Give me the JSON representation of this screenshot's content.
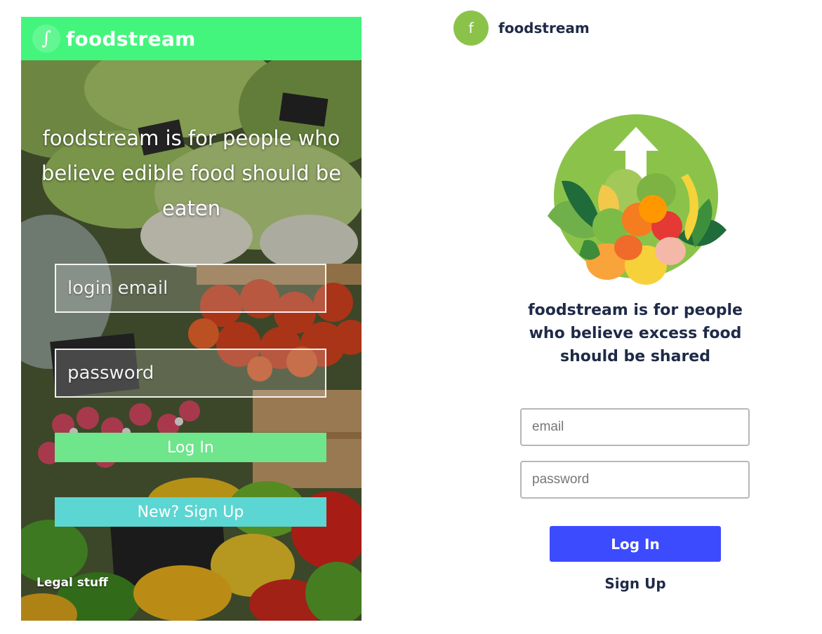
{
  "old_design": {
    "logo_icon": "∫",
    "brand": "foodstream",
    "tagline": "foodstream is for people who believe edible food should be eaten",
    "email_placeholder": "login email",
    "password_placeholder": "password",
    "login_label": "Log In",
    "signup_label": "New? Sign Up",
    "legal_label": "Legal stuff",
    "header_color": "#44f57d",
    "login_color": "#6fe58c",
    "signup_color": "#5cd6d2",
    "background_image": "vegetable-market-photo"
  },
  "new_design": {
    "logo_letter": "f",
    "brand": "foodstream",
    "hero_image": "produce-bowl-with-up-arrow",
    "tagline": "foodstream is for people who believe excess food should be shared",
    "email_placeholder": "email",
    "password_placeholder": "password",
    "login_label": "Log In",
    "signup_label": "Sign Up",
    "brand_color": "#8bc34a",
    "text_color": "#1f2a48",
    "button_color": "#3d4bff"
  }
}
